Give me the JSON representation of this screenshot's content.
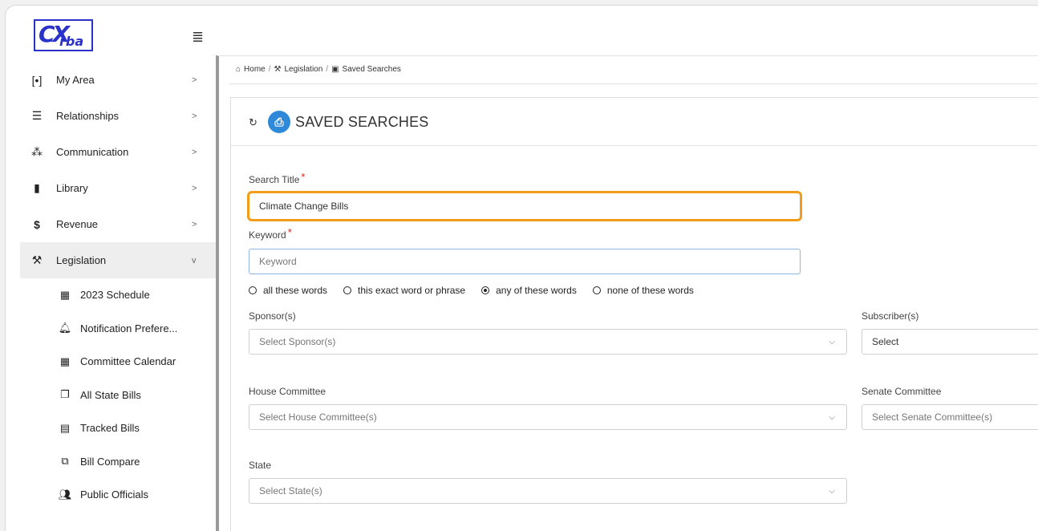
{
  "logo": {
    "line1": "CX",
    "line2": "rba"
  },
  "sidebar": {
    "items": [
      {
        "label": "My Area",
        "chevron": ">"
      },
      {
        "label": "Relationships",
        "chevron": ">"
      },
      {
        "label": "Communication",
        "chevron": ">"
      },
      {
        "label": "Library",
        "chevron": ">"
      },
      {
        "label": "Revenue",
        "chevron": ">"
      },
      {
        "label": "Legislation",
        "chevron": "v"
      }
    ],
    "sub_items": [
      {
        "label": "2023 Schedule"
      },
      {
        "label": "Notification Prefere..."
      },
      {
        "label": "Committee Calendar"
      },
      {
        "label": "All State Bills"
      },
      {
        "label": "Tracked Bills"
      },
      {
        "label": "Bill Compare"
      },
      {
        "label": "Public Officials"
      }
    ]
  },
  "breadcrumb": {
    "home": "Home",
    "sep": "/",
    "legislation": "Legislation",
    "current": "Saved Searches"
  },
  "page": {
    "title": "SAVED SEARCHES",
    "search_title_label": "Search Title",
    "search_title_value": "Climate Change Bills",
    "keyword_label": "Keyword",
    "keyword_placeholder": "Keyword",
    "required_mark": "*",
    "radio_options": [
      "all these words",
      "this exact word or phrase",
      "any of these words",
      "none of these words"
    ],
    "radio_selected": "any of these words",
    "sponsor_label": "Sponsor(s)",
    "sponsor_placeholder": "Select Sponsor(s)",
    "subscriber_label": "Subscriber(s)",
    "subscriber_placeholder": "Select",
    "house_label": "House Committee",
    "house_placeholder": "Select House Committee(s)",
    "senate_label": "Senate Committee",
    "senate_placeholder": "Select Senate Committee(s)",
    "state_label": "State",
    "state_placeholder": "Select State(s)"
  },
  "colors": {
    "highlight": "#f39c1a",
    "accent": "#2e8ad8",
    "required": "#e2231a"
  }
}
